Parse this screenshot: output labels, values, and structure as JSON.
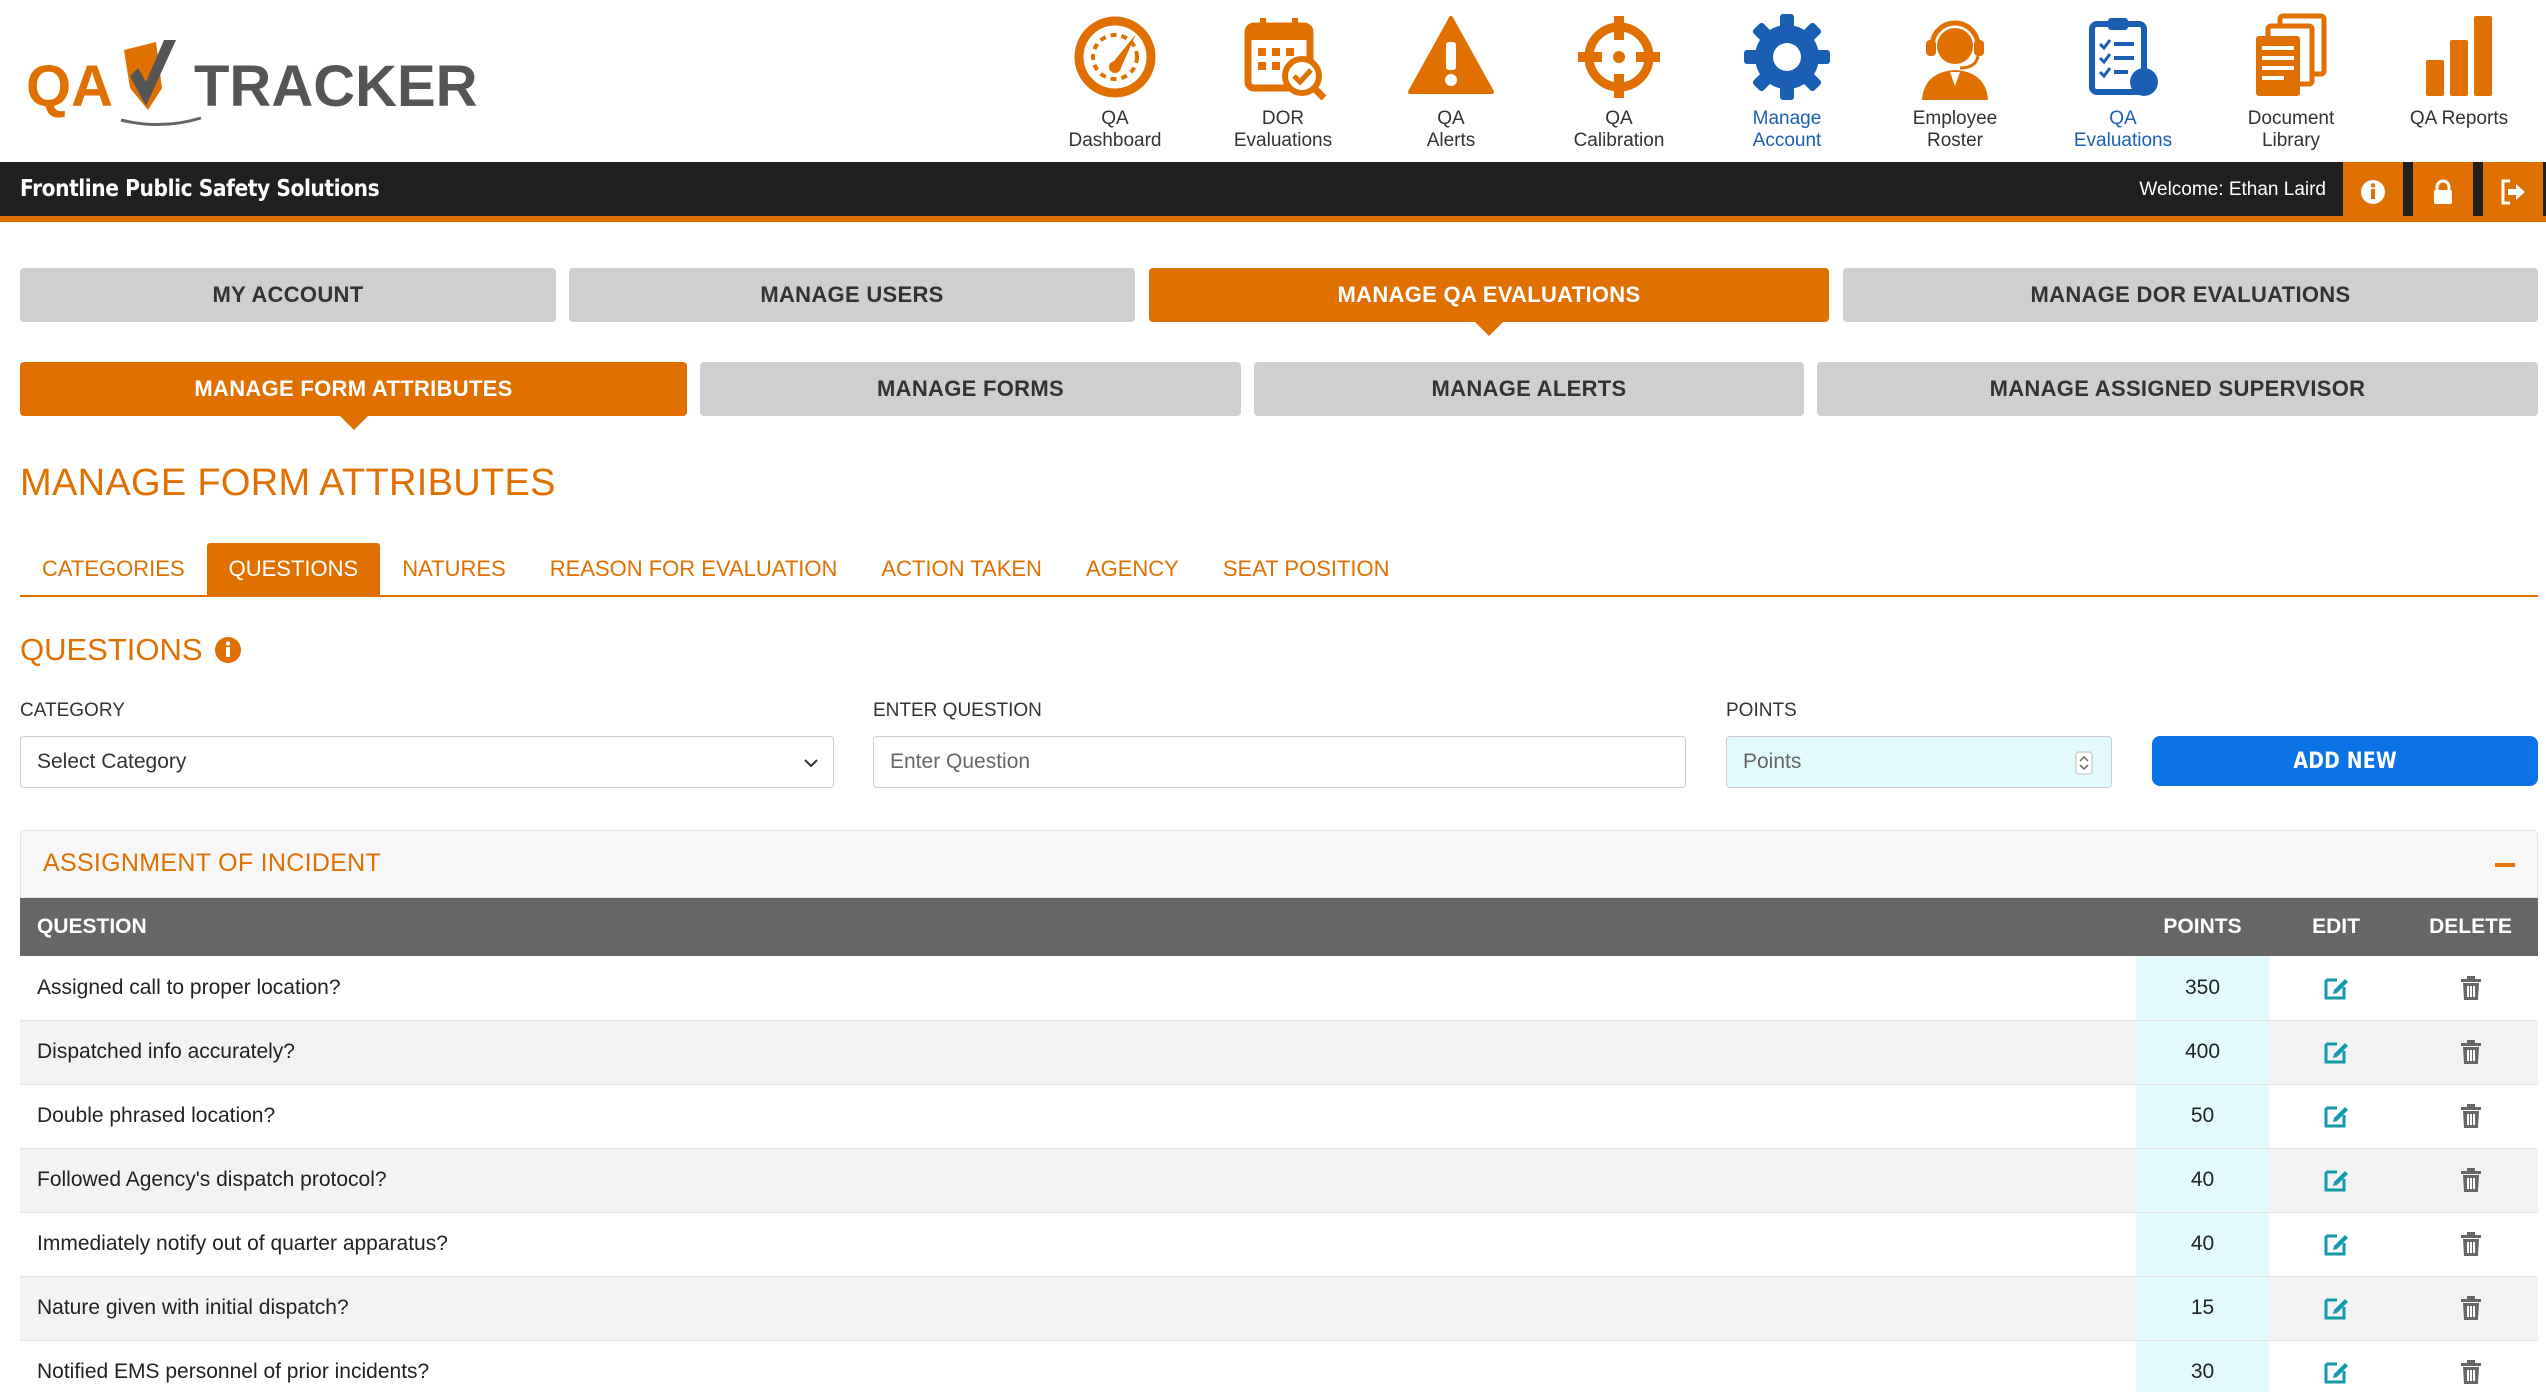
{
  "brand": {
    "logo_text_left": "QA",
    "logo_text_right": "TRACKER",
    "org_name": "Frontline Public Safety Solutions",
    "welcome": "Welcome: Ethan Laird",
    "accent": "#e07000",
    "active_blue": "#1a5fb4"
  },
  "nav": [
    {
      "label": "QA\nDashboard",
      "icon": "gauge-icon"
    },
    {
      "label": "DOR\nEvaluations",
      "icon": "calendar-check-icon"
    },
    {
      "label": "QA\nAlerts",
      "icon": "warning-icon"
    },
    {
      "label": "QA\nCalibration",
      "icon": "crosshair-icon"
    },
    {
      "label": "Manage\nAccount",
      "icon": "gear-icon"
    },
    {
      "label": "Employee\nRoster",
      "icon": "headset-user-icon"
    },
    {
      "label": "QA\nEvaluations",
      "icon": "clipboard-list-icon"
    },
    {
      "label": "Document\nLibrary",
      "icon": "documents-icon"
    },
    {
      "label": "QA Reports",
      "icon": "bar-chart-icon"
    }
  ],
  "main_tabs": {
    "my_account": "MY ACCOUNT",
    "manage_users": "MANAGE USERS",
    "manage_qa": "MANAGE QA EVALUATIONS",
    "manage_dor": "MANAGE DOR EVALUATIONS"
  },
  "sub_tabs": {
    "form_attributes": "MANAGE FORM ATTRIBUTES",
    "forms": "MANAGE FORMS",
    "alerts": "MANAGE ALERTS",
    "assigned_supervisor": "MANAGE ASSIGNED SUPERVISOR"
  },
  "page_title": "MANAGE FORM ATTRIBUTES",
  "attr_tabs": [
    "CATEGORIES",
    "QUESTIONS",
    "NATURES",
    "REASON FOR EVALUATION",
    "ACTION TAKEN",
    "AGENCY",
    "SEAT POSITION"
  ],
  "questions": {
    "title": "QUESTIONS",
    "category_label": "CATEGORY",
    "category_value": "Select Category",
    "question_label": "ENTER QUESTION",
    "question_placeholder": "Enter Question",
    "points_label": "POINTS",
    "points_placeholder": "Points",
    "add_button": "ADD NEW"
  },
  "panel": {
    "title": "ASSIGNMENT OF INCIDENT",
    "headers": {
      "question": "QUESTION",
      "points": "POINTS",
      "edit": "EDIT",
      "delete": "DELETE"
    },
    "rows": [
      {
        "question": "Assigned call to proper location?",
        "points": "350"
      },
      {
        "question": "Dispatched info accurately?",
        "points": "400"
      },
      {
        "question": "Double phrased location?",
        "points": "50"
      },
      {
        "question": "Followed Agency's dispatch protocol?",
        "points": "40"
      },
      {
        "question": "Immediately notify out of quarter apparatus?",
        "points": "40"
      },
      {
        "question": "Nature given with initial dispatch?",
        "points": "15"
      },
      {
        "question": "Notified EMS personnel of prior incidents?",
        "points": "30"
      }
    ]
  }
}
